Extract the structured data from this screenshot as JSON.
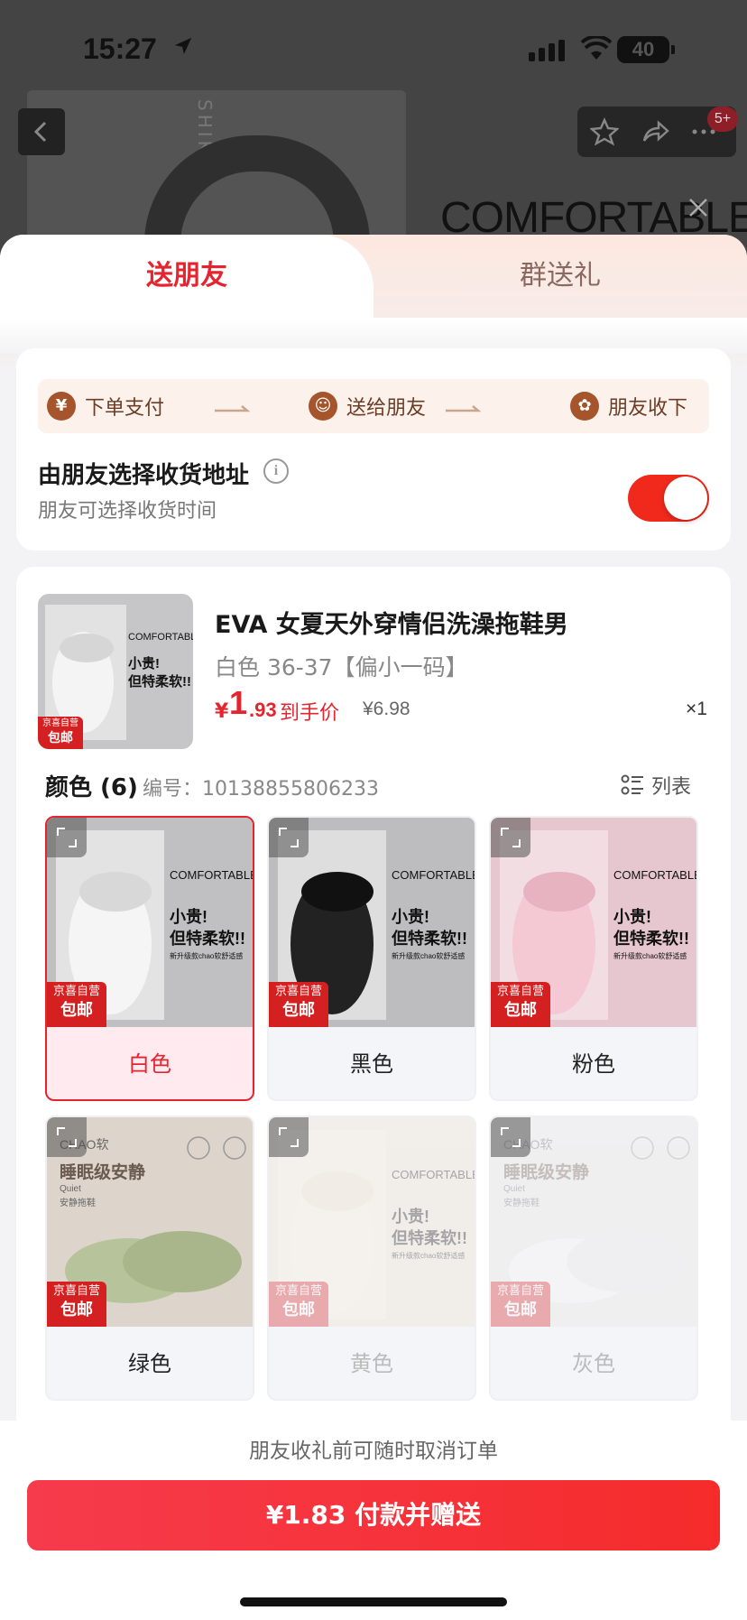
{
  "status_bar": {
    "time": "15:27",
    "battery": "40"
  },
  "background": {
    "title": "COMFORTABLE",
    "cart_badge": "5+",
    "box_side_text": "SHIKKO"
  },
  "tabs": {
    "send_friend": "送朋友",
    "group_gift": "群送礼"
  },
  "flow": {
    "steps": [
      {
        "icon": "¥",
        "label": "下单支付"
      },
      {
        "icon": "☺",
        "label": "送给朋友"
      },
      {
        "icon": "✿",
        "label": "朋友收下"
      }
    ]
  },
  "address": {
    "title": "由朋友选择收货地址",
    "subtitle": "朋友可选择收货时间",
    "info_icon": "i",
    "toggle_on": true
  },
  "product": {
    "name": "EVA 女夏天外穿情侣洗澡拖鞋男",
    "spec": "白色 36-37【偏小一码】",
    "price_symbol": "¥",
    "price_int": "1",
    "price_dec": ".93",
    "price_label": "到手价",
    "original_price": "¥6.98",
    "quantity": "×1",
    "image_text": {
      "brand": "COMFORTABLE",
      "line1": "小贵!",
      "line2": "但特柔软!!",
      "line3": "新升级款chao软舒适感",
      "tag_top": "京喜自营",
      "tag_bottom": "包邮"
    }
  },
  "color_section": {
    "title": "颜色 (6)",
    "sku": "编号：10138855806233",
    "list_label": "列表"
  },
  "color_options": [
    {
      "label": "白色",
      "state": "selected",
      "style": "white"
    },
    {
      "label": "黑色",
      "state": "normal",
      "style": "black"
    },
    {
      "label": "粉色",
      "state": "normal",
      "style": "pink"
    },
    {
      "label": "绿色",
      "state": "normal",
      "style": "green"
    },
    {
      "label": "黄色",
      "state": "disabled",
      "style": "yellow"
    },
    {
      "label": "灰色",
      "state": "disabled",
      "style": "grey"
    }
  ],
  "alt_image_text": {
    "brand": "CHAO软",
    "line1": "睡眠级安静",
    "line2": "Quiet",
    "line3": "安静拖鞋"
  },
  "footer": {
    "note": "朋友收礼前可随时取消订单",
    "pay_button": "¥1.83 付款并赠送"
  },
  "colors": {
    "accent": "#e4242f",
    "toggle": "#f0291c",
    "flow_icon": "#a5542b",
    "tag": "#d42020"
  }
}
